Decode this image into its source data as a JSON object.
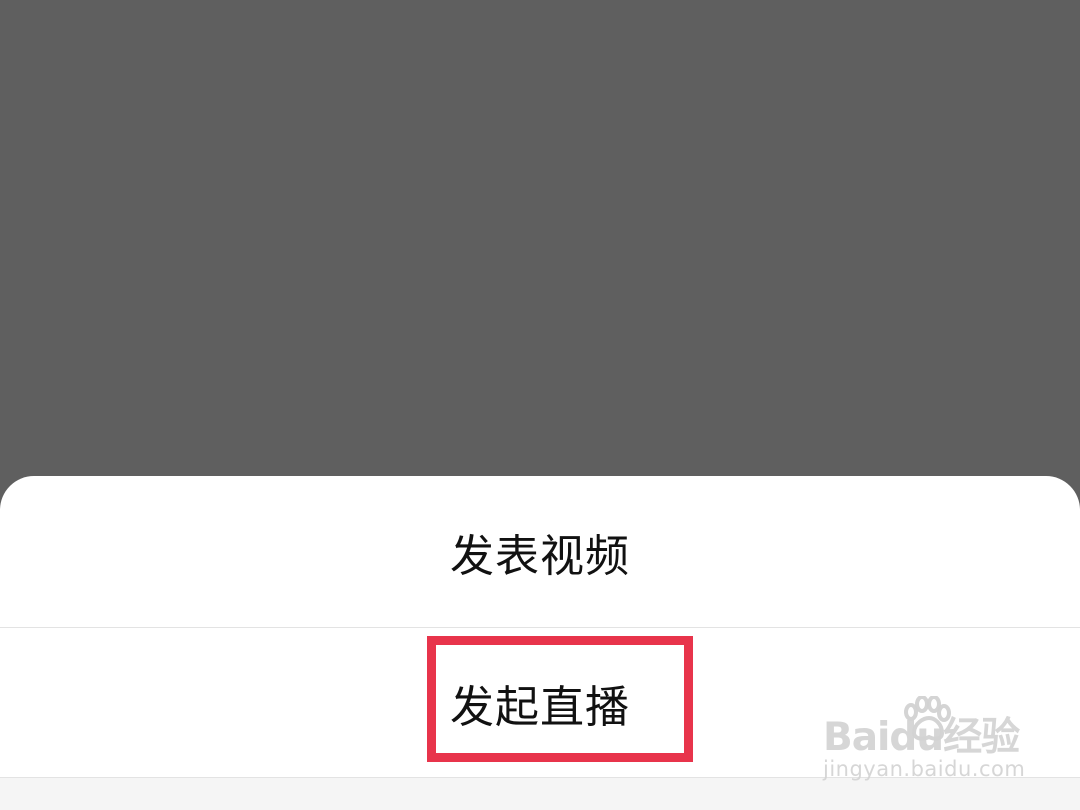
{
  "sheet": {
    "options": [
      {
        "label": "发表视频"
      },
      {
        "label": "发起直播"
      }
    ]
  },
  "watermark": {
    "brand": "Bai",
    "brand_suffix": "du",
    "site": "经验",
    "url": "jingyan.baidu.com"
  },
  "colors": {
    "overlay": "#5f5f5f",
    "sheet": "#ffffff",
    "divider": "#e3e3e3",
    "highlight": "#e8344b",
    "text": "#111111"
  },
  "icons": {
    "watermark_mark": "paw-icon"
  }
}
